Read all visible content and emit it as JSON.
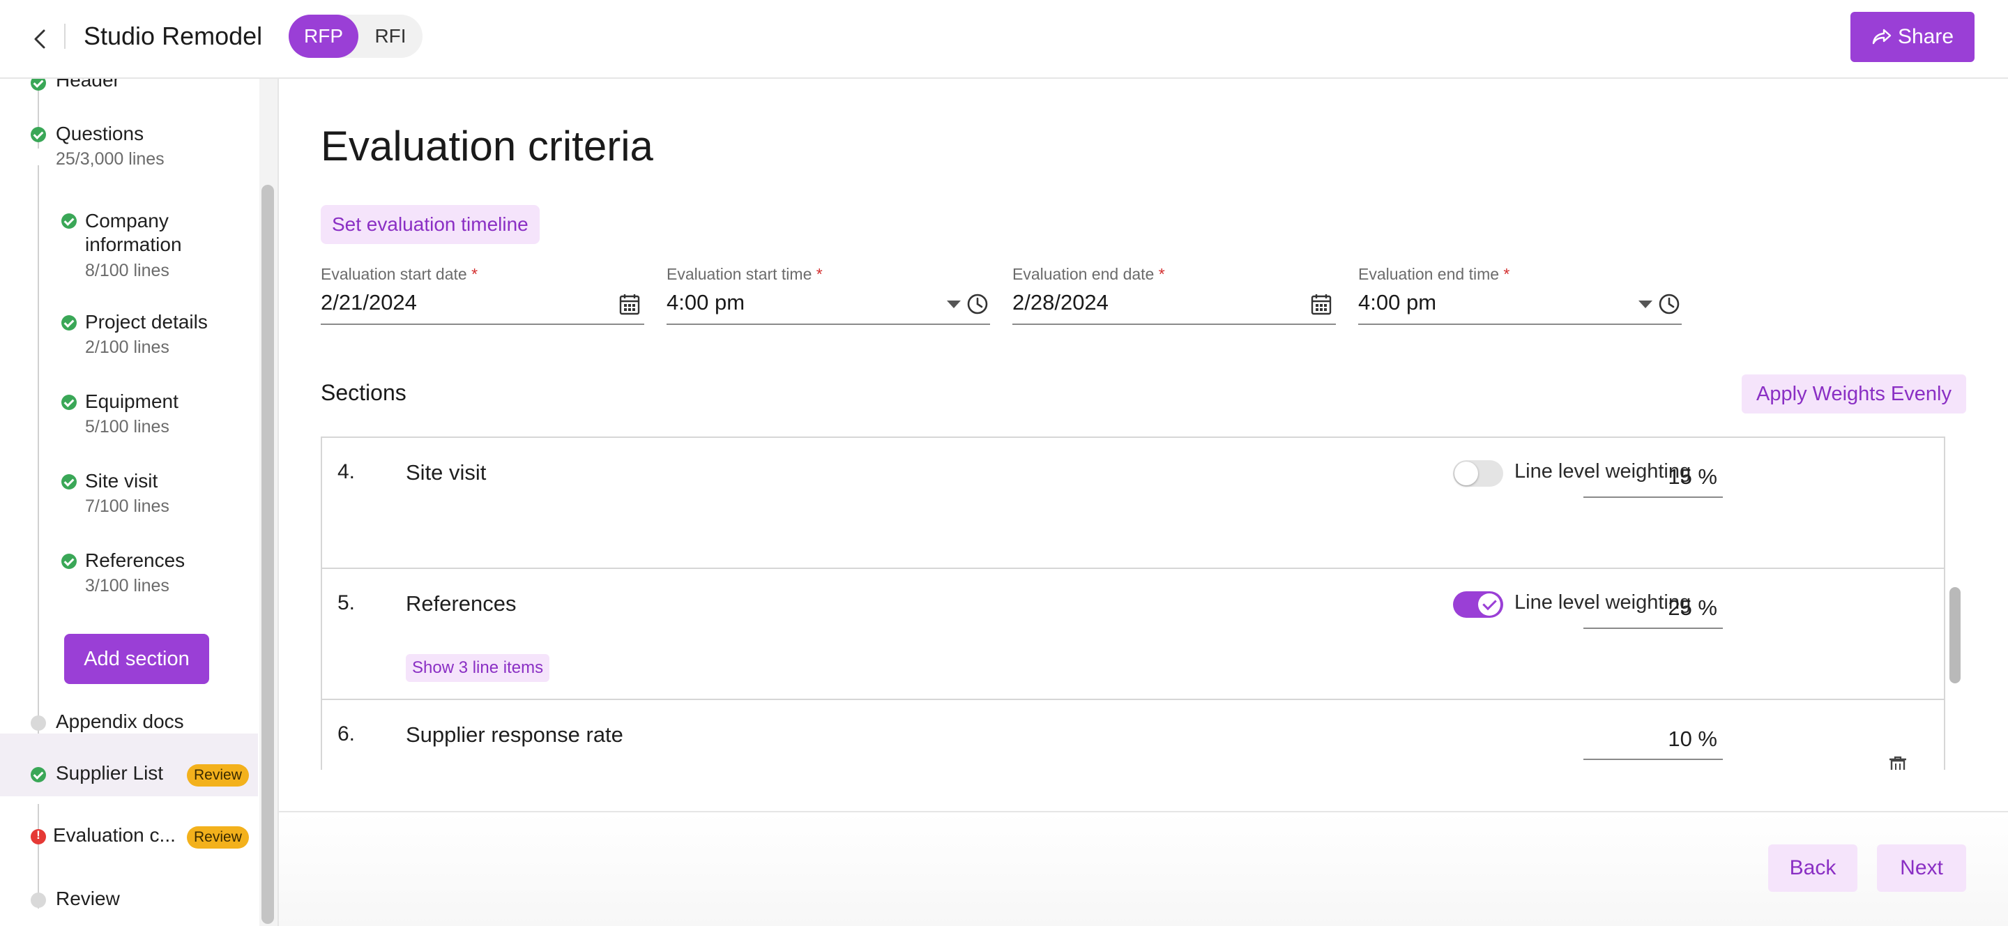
{
  "header": {
    "title": "Studio Remodel",
    "segments": [
      "RFP",
      "RFI"
    ],
    "share_label": "Share"
  },
  "sidebar": {
    "items": [
      {
        "label": "Header",
        "status": "complete"
      },
      {
        "label": "Questions",
        "sub": "25/3,000 lines",
        "status": "complete"
      },
      {
        "label": "Company information",
        "sub": "8/100 lines",
        "status": "complete"
      },
      {
        "label": "Project details",
        "sub": "2/100 lines",
        "status": "complete"
      },
      {
        "label": "Equipment",
        "sub": "5/100 lines",
        "status": "complete"
      },
      {
        "label": "Site visit",
        "sub": "7/100 lines",
        "status": "complete"
      },
      {
        "label": "References",
        "sub": "3/100 lines",
        "status": "complete"
      },
      {
        "label": "Appendix docs",
        "status": "empty"
      },
      {
        "label": "Supplier List",
        "badge": "Review",
        "status": "complete"
      },
      {
        "label": "Evaluation c...",
        "badge": "Review",
        "status": "error"
      },
      {
        "label": "Review",
        "status": "empty"
      }
    ],
    "add_section_label": "Add section"
  },
  "main": {
    "title": "Evaluation criteria",
    "timeline_chip": "Set evaluation timeline",
    "fields": [
      {
        "label": "Evaluation start date",
        "required": "*",
        "value": "2/21/2024"
      },
      {
        "label": "Evaluation start time",
        "required": "*",
        "value": "4:00 pm"
      },
      {
        "label": "Evaluation end date",
        "required": "*",
        "value": "2/28/2024"
      },
      {
        "label": "Evaluation end time",
        "required": "*",
        "value": "4:00 pm"
      }
    ],
    "sections_title": "Sections",
    "apply_weights_label": "Apply Weights Evenly",
    "sections": [
      {
        "num": "4.",
        "name": "Site visit",
        "toggle_label": "Line level weighting",
        "toggle_on": false,
        "weight": "15 %"
      },
      {
        "num": "5.",
        "name": "References",
        "toggle_label": "Line level weighting",
        "toggle_on": true,
        "weight": "25 %",
        "show_items": "Show 3 line items"
      },
      {
        "num": "6.",
        "name": "Supplier response rate",
        "weight": "10 %"
      }
    ]
  },
  "footer": {
    "back_label": "Back",
    "next_label": "Next"
  },
  "colors": {
    "accent": "#9a3fd6",
    "accent_soft": "#f5e4fb",
    "success": "#3aa757",
    "error": "#e53935",
    "badge": "#f3b11c"
  }
}
